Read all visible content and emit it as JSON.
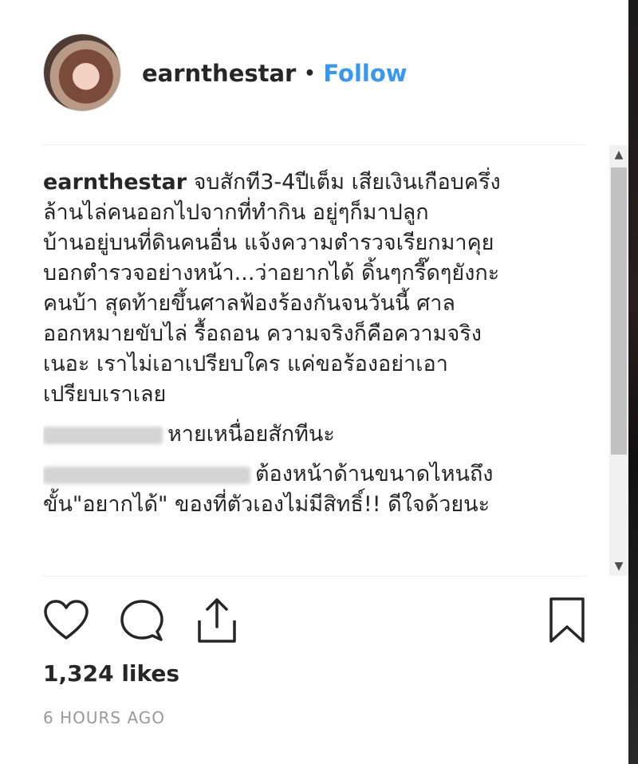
{
  "post": {
    "username": "earnthestar",
    "separator": "•",
    "follow_label": "Follow"
  },
  "caption": {
    "author": "earnthestar",
    "lines": [
      " จบสักที3-4ปีเต็ม เสียเงินเกือบครึ่ง",
      "ล้านไล่คนออกไปจากที่ทำกิน อยู่ๆก็มาปลูก",
      "บ้านอยู่บนที่ดินคนอื่น แจ้งความตำรวจเรียกมาคุย",
      "บอกตำรวจอย่างหน้า...ว่าอยากได้ ดิ้นๆกรี๊ดๆยังกะ",
      "คนบ้า สุดท้ายขึ้นศาลฟ้องร้องกันจนวันนี้ ศาล",
      "ออกหมายขับไล่ รื้อถอน ความจริงก็คือความจริง",
      "เนอะ เราไม่เอาเปรียบใคร แค่ขอร้องอย่าเอา",
      "เปรียบเราเลย"
    ]
  },
  "comments": [
    {
      "text": "หายเหนื่อยสักทีนะ"
    },
    {
      "line1": "ต้องหน้าด้านขนาดไหนถึง",
      "line2": "ขั้น\"อยากได้\" ของที่ตัวเองไม่มีสิทธิ์!! ดีใจด้วยนะ"
    }
  ],
  "icons": {
    "like": "heart-icon",
    "comment": "comment-bubble-icon",
    "share": "share-icon",
    "save": "bookmark-icon"
  },
  "likes_text": "1,324 likes",
  "timestamp": "6 HOURS AGO",
  "colors": {
    "follow": "#3897f0",
    "text": "#262626",
    "muted": "#999999"
  }
}
